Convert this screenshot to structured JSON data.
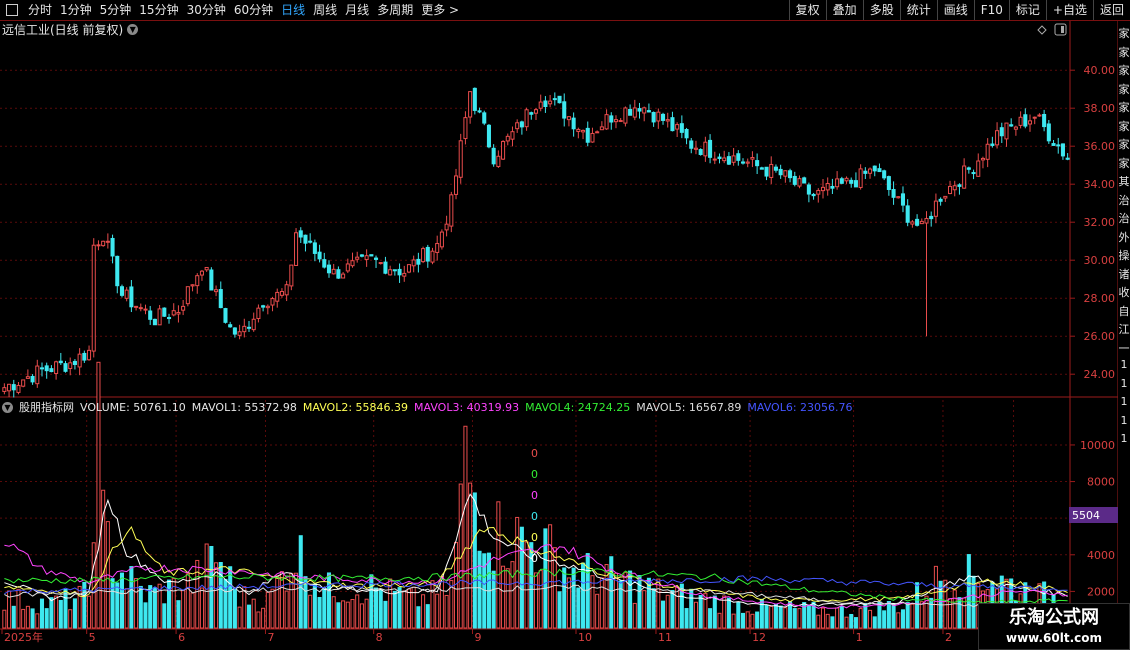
{
  "toolbar": {
    "periods": [
      "分时",
      "1分钟",
      "5分钟",
      "15分钟",
      "30分钟",
      "60分钟",
      "日线",
      "周线",
      "月线",
      "多周期",
      "更多 >"
    ],
    "active_period": "日线",
    "right_buttons": [
      "复权",
      "叠加",
      "多股",
      "统计",
      "画线",
      "F10",
      "标记",
      "+自选",
      "返回"
    ]
  },
  "price_chart": {
    "title": "远信工业(日线 前复权)",
    "y_ticks": [
      "40.00",
      "38.00",
      "36.00",
      "34.00",
      "32.00",
      "30.00",
      "28.00",
      "26.00",
      "24.00"
    ]
  },
  "volume_chart": {
    "legend": [
      {
        "label": "股朋指标网",
        "color": "#e6e6e6"
      },
      {
        "label": "VOLUME: 50761.10",
        "color": "#e6e6e6"
      },
      {
        "label": "MAVOL1: 55372.98",
        "color": "#e6e6e6"
      },
      {
        "label": "MAVOL2: 55846.39",
        "color": "#ffff55"
      },
      {
        "label": "MAVOL3: 40319.93",
        "color": "#ff44ff"
      },
      {
        "label": "MAVOL4: 24724.25",
        "color": "#33ee33"
      },
      {
        "label": "MAVOL5: 16567.89",
        "color": "#dddddd"
      },
      {
        "label": "MAVOL6: 23056.76",
        "color": "#4455ff"
      }
    ],
    "y_ticks": [
      "10000",
      "8000",
      "6000",
      "4000",
      "2000"
    ],
    "current_marker": "5504",
    "zero_labels": [
      "0",
      "0",
      "0",
      "0",
      "0",
      "0"
    ]
  },
  "x_axis": {
    "labels": [
      "2025年",
      "5",
      "6",
      "7",
      "8",
      "9",
      "10",
      "11",
      "12",
      "1",
      "2",
      "3"
    ]
  },
  "right_strip_chars": [
    "家",
    "家",
    "家",
    "家",
    "家",
    "家",
    "家",
    "家",
    "其",
    "治",
    "治",
    "外",
    "操",
    "诸",
    "收",
    "自",
    "江",
    "一",
    "1",
    "1",
    "1",
    "1",
    "1"
  ],
  "watermark": {
    "title": "乐淘公式网",
    "url": "www.60lt.com"
  },
  "colors": {
    "up": "#e84c4c",
    "down": "#3ee8f0",
    "grid": "#5a0a0a",
    "axis": "#9b1b1b",
    "tick_text": "#d84040"
  },
  "chart_data": {
    "type": "candlestick",
    "title": "远信工业(日线 前复权)",
    "ylim_price": [
      22.8,
      41.8
    ],
    "ylim_volume": [
      0,
      11800
    ],
    "months": [
      {
        "label": "2025年",
        "days": 18
      },
      {
        "label": "5",
        "days": 19
      },
      {
        "label": "6",
        "days": 19
      },
      {
        "label": "7",
        "days": 23
      },
      {
        "label": "8",
        "days": 21
      },
      {
        "label": "9",
        "days": 22
      },
      {
        "label": "10",
        "days": 17
      },
      {
        "label": "11",
        "days": 20
      },
      {
        "label": "12",
        "days": 22
      },
      {
        "label": "1",
        "days": 19
      },
      {
        "label": "2",
        "days": 15
      },
      {
        "label": "3",
        "days": 12
      }
    ],
    "close_anchors": [
      [
        0,
        23.3
      ],
      [
        8,
        24.2
      ],
      [
        14,
        24.6
      ],
      [
        18,
        25.2
      ],
      [
        19,
        30.8
      ],
      [
        21,
        31.4
      ],
      [
        25,
        28.2
      ],
      [
        32,
        26.9
      ],
      [
        37,
        27.4
      ],
      [
        42,
        29.8
      ],
      [
        48,
        26.4
      ],
      [
        50,
        26.0
      ],
      [
        55,
        27.9
      ],
      [
        60,
        28.3
      ],
      [
        62,
        31.5
      ],
      [
        70,
        29.3
      ],
      [
        78,
        30.0
      ],
      [
        85,
        29.4
      ],
      [
        92,
        30.8
      ],
      [
        95,
        33.0
      ],
      [
        99,
        38.9
      ],
      [
        104,
        35.5
      ],
      [
        109,
        36.9
      ],
      [
        114,
        38.7
      ],
      [
        119,
        37.8
      ],
      [
        124,
        36.6
      ],
      [
        129,
        37.6
      ],
      [
        135,
        38.2
      ],
      [
        140,
        37.4
      ],
      [
        146,
        36.1
      ],
      [
        155,
        35.4
      ],
      [
        165,
        34.5
      ],
      [
        172,
        33.4
      ],
      [
        180,
        34.1
      ],
      [
        185,
        34.8
      ],
      [
        190,
        33.0
      ],
      [
        192,
        32.4
      ],
      [
        195,
        31.6
      ],
      [
        199,
        33.4
      ],
      [
        206,
        35.0
      ],
      [
        211,
        36.6
      ],
      [
        219,
        37.6
      ],
      [
        226,
        35.4
      ],
      [
        233,
        36.3
      ],
      [
        239,
        34.9
      ],
      [
        244,
        33.4
      ],
      [
        248,
        32.2
      ],
      [
        252,
        34.8
      ],
      [
        255,
        37.8
      ],
      [
        258,
        38.4
      ],
      [
        262,
        36.2
      ],
      [
        263,
        34.1
      ],
      [
        265,
        33.1
      ],
      [
        268,
        36.8
      ],
      [
        271,
        38.4
      ],
      [
        273,
        40.3
      ]
    ],
    "volume_anchors": [
      [
        0,
        1600
      ],
      [
        10,
        1300
      ],
      [
        18,
        1800
      ],
      [
        19,
        8200
      ],
      [
        20,
        11000
      ],
      [
        21,
        5500
      ],
      [
        24,
        3200
      ],
      [
        30,
        1800
      ],
      [
        40,
        2400
      ],
      [
        45,
        3900
      ],
      [
        50,
        1700
      ],
      [
        56,
        1500
      ],
      [
        62,
        4200
      ],
      [
        68,
        2100
      ],
      [
        78,
        2200
      ],
      [
        88,
        1500
      ],
      [
        95,
        2200
      ],
      [
        98,
        8900
      ],
      [
        100,
        7300
      ],
      [
        104,
        5200
      ],
      [
        110,
        4800
      ],
      [
        115,
        4300
      ],
      [
        120,
        3100
      ],
      [
        130,
        2700
      ],
      [
        140,
        1900
      ],
      [
        160,
        1100
      ],
      [
        180,
        900
      ],
      [
        192,
        1300
      ],
      [
        194,
        1800
      ],
      [
        200,
        2900
      ],
      [
        210,
        2700
      ],
      [
        220,
        1800
      ],
      [
        235,
        1300
      ],
      [
        247,
        1300
      ],
      [
        252,
        2600
      ],
      [
        256,
        6500
      ],
      [
        259,
        4800
      ],
      [
        262,
        4200
      ],
      [
        264,
        9800
      ],
      [
        265,
        3600
      ],
      [
        268,
        6000
      ],
      [
        270,
        6700
      ],
      [
        273,
        5500
      ]
    ],
    "ma_lines": [
      {
        "name": "MAVOL1",
        "color": "#ffffff",
        "anchors": [
          [
            0,
            2600
          ],
          [
            10,
            1600
          ],
          [
            18,
            1900
          ],
          [
            22,
            7300
          ],
          [
            26,
            4200
          ],
          [
            35,
            2400
          ],
          [
            45,
            3000
          ],
          [
            52,
            1800
          ],
          [
            60,
            3200
          ],
          [
            65,
            2300
          ],
          [
            80,
            2000
          ],
          [
            92,
            2000
          ],
          [
            99,
            7300
          ],
          [
            104,
            5000
          ],
          [
            110,
            4100
          ],
          [
            118,
            3600
          ],
          [
            130,
            2600
          ],
          [
            145,
            1700
          ],
          [
            165,
            1200
          ],
          [
            190,
            1400
          ],
          [
            205,
            2800
          ],
          [
            215,
            2200
          ],
          [
            235,
            1500
          ],
          [
            250,
            1700
          ],
          [
            258,
            4500
          ],
          [
            265,
            6200
          ],
          [
            273,
            5500
          ]
        ]
      },
      {
        "name": "MAVOL2",
        "color": "#ffff55",
        "anchors": [
          [
            0,
            2300
          ],
          [
            18,
            1800
          ],
          [
            26,
            5500
          ],
          [
            34,
            3000
          ],
          [
            48,
            3200
          ],
          [
            60,
            2600
          ],
          [
            75,
            2300
          ],
          [
            92,
            2400
          ],
          [
            102,
            5600
          ],
          [
            112,
            4400
          ],
          [
            125,
            3200
          ],
          [
            140,
            2300
          ],
          [
            165,
            1500
          ],
          [
            190,
            1600
          ],
          [
            210,
            2600
          ],
          [
            235,
            1700
          ],
          [
            255,
            2600
          ],
          [
            265,
            5200
          ],
          [
            273,
            5600
          ]
        ]
      },
      {
        "name": "MAVOL3",
        "color": "#ff44ff",
        "anchors": [
          [
            0,
            4800
          ],
          [
            8,
            3200
          ],
          [
            18,
            2500
          ],
          [
            30,
            3300
          ],
          [
            45,
            3200
          ],
          [
            62,
            2800
          ],
          [
            80,
            2600
          ],
          [
            92,
            2500
          ],
          [
            105,
            3800
          ],
          [
            118,
            4500
          ],
          [
            130,
            3100
          ],
          [
            150,
            1700
          ],
          [
            175,
            1100
          ],
          [
            195,
            1400
          ],
          [
            215,
            2000
          ],
          [
            240,
            1700
          ],
          [
            255,
            2000
          ],
          [
            265,
            3400
          ],
          [
            273,
            4000
          ]
        ]
      },
      {
        "name": "MAVOL4",
        "color": "#33ee33",
        "anchors": [
          [
            0,
            2600
          ],
          [
            20,
            2600
          ],
          [
            45,
            2800
          ],
          [
            75,
            2700
          ],
          [
            95,
            2800
          ],
          [
            120,
            3100
          ],
          [
            150,
            2800
          ],
          [
            170,
            2100
          ],
          [
            190,
            1600
          ],
          [
            205,
            1400
          ],
          [
            225,
            1500
          ],
          [
            250,
            1500
          ],
          [
            265,
            1900
          ],
          [
            273,
            2500
          ]
        ]
      },
      {
        "name": "MAVOL5",
        "color": "#dddddd",
        "anchors": [
          [
            0,
            1800
          ],
          [
            25,
            2000
          ],
          [
            60,
            2100
          ],
          [
            90,
            2100
          ],
          [
            120,
            2200
          ],
          [
            150,
            2000
          ],
          [
            180,
            1400
          ],
          [
            210,
            1200
          ],
          [
            245,
            1100
          ],
          [
            273,
            1650
          ]
        ]
      },
      {
        "name": "MAVOL6",
        "color": "#4455ff",
        "anchors": [
          [
            0,
            2000
          ],
          [
            40,
            2200
          ],
          [
            80,
            2400
          ],
          [
            120,
            2500
          ],
          [
            160,
            2700
          ],
          [
            200,
            2300
          ],
          [
            240,
            2100
          ],
          [
            273,
            2300
          ]
        ]
      }
    ]
  }
}
